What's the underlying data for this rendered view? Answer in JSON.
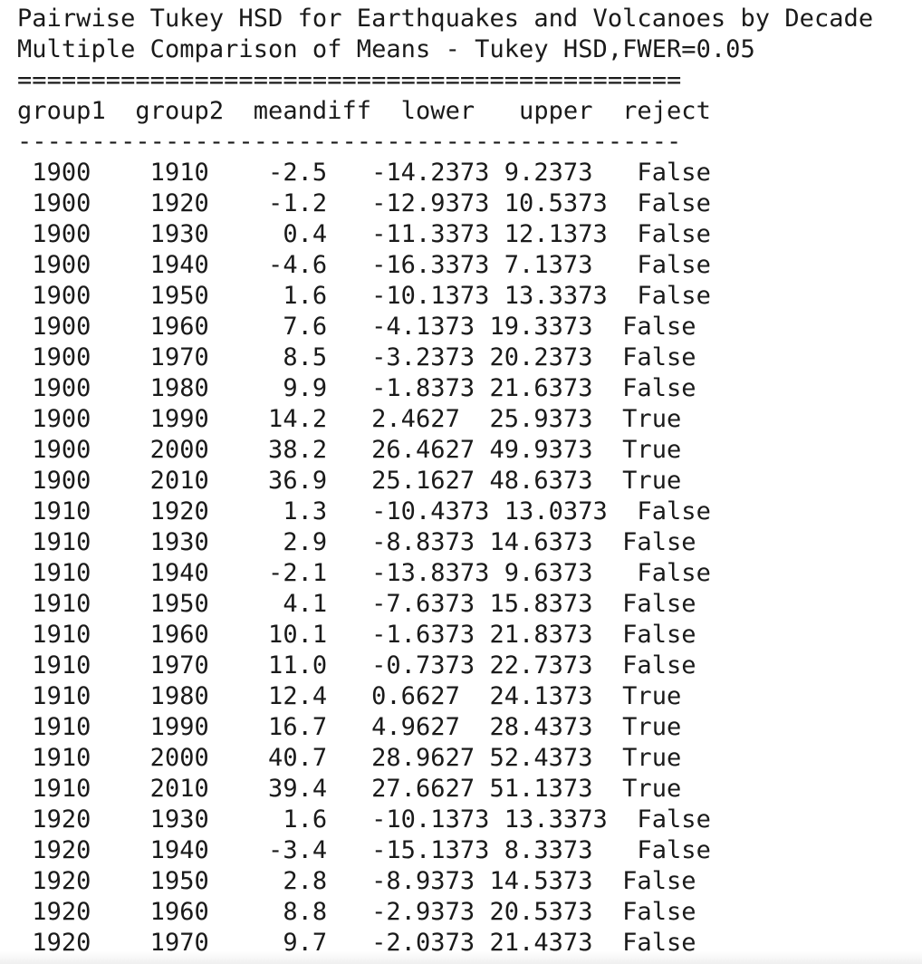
{
  "title": "Pairwise Tukey HSD for Earthquakes and Volcanoes by Decade",
  "summary": {
    "heading": "Multiple Comparison of Means - Tukey HSD,FWER=0.05",
    "rule_top": "=============================================",
    "columns": [
      "group1",
      "group2",
      "meandiff",
      "lower",
      "upper",
      "reject"
    ],
    "rule_mid": "---------------------------------------------",
    "rows": [
      [
        "1900",
        "1910",
        "-2.5",
        "-14.2373",
        "9.2373",
        "False"
      ],
      [
        "1900",
        "1920",
        "-1.2",
        "-12.9373",
        "10.5373",
        "False"
      ],
      [
        "1900",
        "1930",
        "0.4",
        "-11.3373",
        "12.1373",
        "False"
      ],
      [
        "1900",
        "1940",
        "-4.6",
        "-16.3373",
        "7.1373",
        "False"
      ],
      [
        "1900",
        "1950",
        "1.6",
        "-10.1373",
        "13.3373",
        "False"
      ],
      [
        "1900",
        "1960",
        "7.6",
        "-4.1373",
        "19.3373",
        "False"
      ],
      [
        "1900",
        "1970",
        "8.5",
        "-3.2373",
        "20.2373",
        "False"
      ],
      [
        "1900",
        "1980",
        "9.9",
        "-1.8373",
        "21.6373",
        "False"
      ],
      [
        "1900",
        "1990",
        "14.2",
        "2.4627",
        "25.9373",
        "True"
      ],
      [
        "1900",
        "2000",
        "38.2",
        "26.4627",
        "49.9373",
        "True"
      ],
      [
        "1900",
        "2010",
        "36.9",
        "25.1627",
        "48.6373",
        "True"
      ],
      [
        "1910",
        "1920",
        "1.3",
        "-10.4373",
        "13.0373",
        "False"
      ],
      [
        "1910",
        "1930",
        "2.9",
        "-8.8373",
        "14.6373",
        "False"
      ],
      [
        "1910",
        "1940",
        "-2.1",
        "-13.8373",
        "9.6373",
        "False"
      ],
      [
        "1910",
        "1950",
        "4.1",
        "-7.6373",
        "15.8373",
        "False"
      ],
      [
        "1910",
        "1960",
        "10.1",
        "-1.6373",
        "21.8373",
        "False"
      ],
      [
        "1910",
        "1970",
        "11.0",
        "-0.7373",
        "22.7373",
        "False"
      ],
      [
        "1910",
        "1980",
        "12.4",
        "0.6627",
        "24.1373",
        "True"
      ],
      [
        "1910",
        "1990",
        "16.7",
        "4.9627",
        "28.4373",
        "True"
      ],
      [
        "1910",
        "2000",
        "40.7",
        "28.9627",
        "52.4373",
        "True"
      ],
      [
        "1910",
        "2010",
        "39.4",
        "27.6627",
        "51.1373",
        "True"
      ],
      [
        "1920",
        "1930",
        "1.6",
        "-10.1373",
        "13.3373",
        "False"
      ],
      [
        "1920",
        "1940",
        "-3.4",
        "-15.1373",
        "8.3373",
        "False"
      ],
      [
        "1920",
        "1950",
        "2.8",
        "-8.9373",
        "14.5373",
        "False"
      ],
      [
        "1920",
        "1960",
        "8.8",
        "-2.9373",
        "20.5373",
        "False"
      ],
      [
        "1920",
        "1970",
        "9.7",
        "-2.0373",
        "21.4373",
        "False"
      ]
    ]
  }
}
